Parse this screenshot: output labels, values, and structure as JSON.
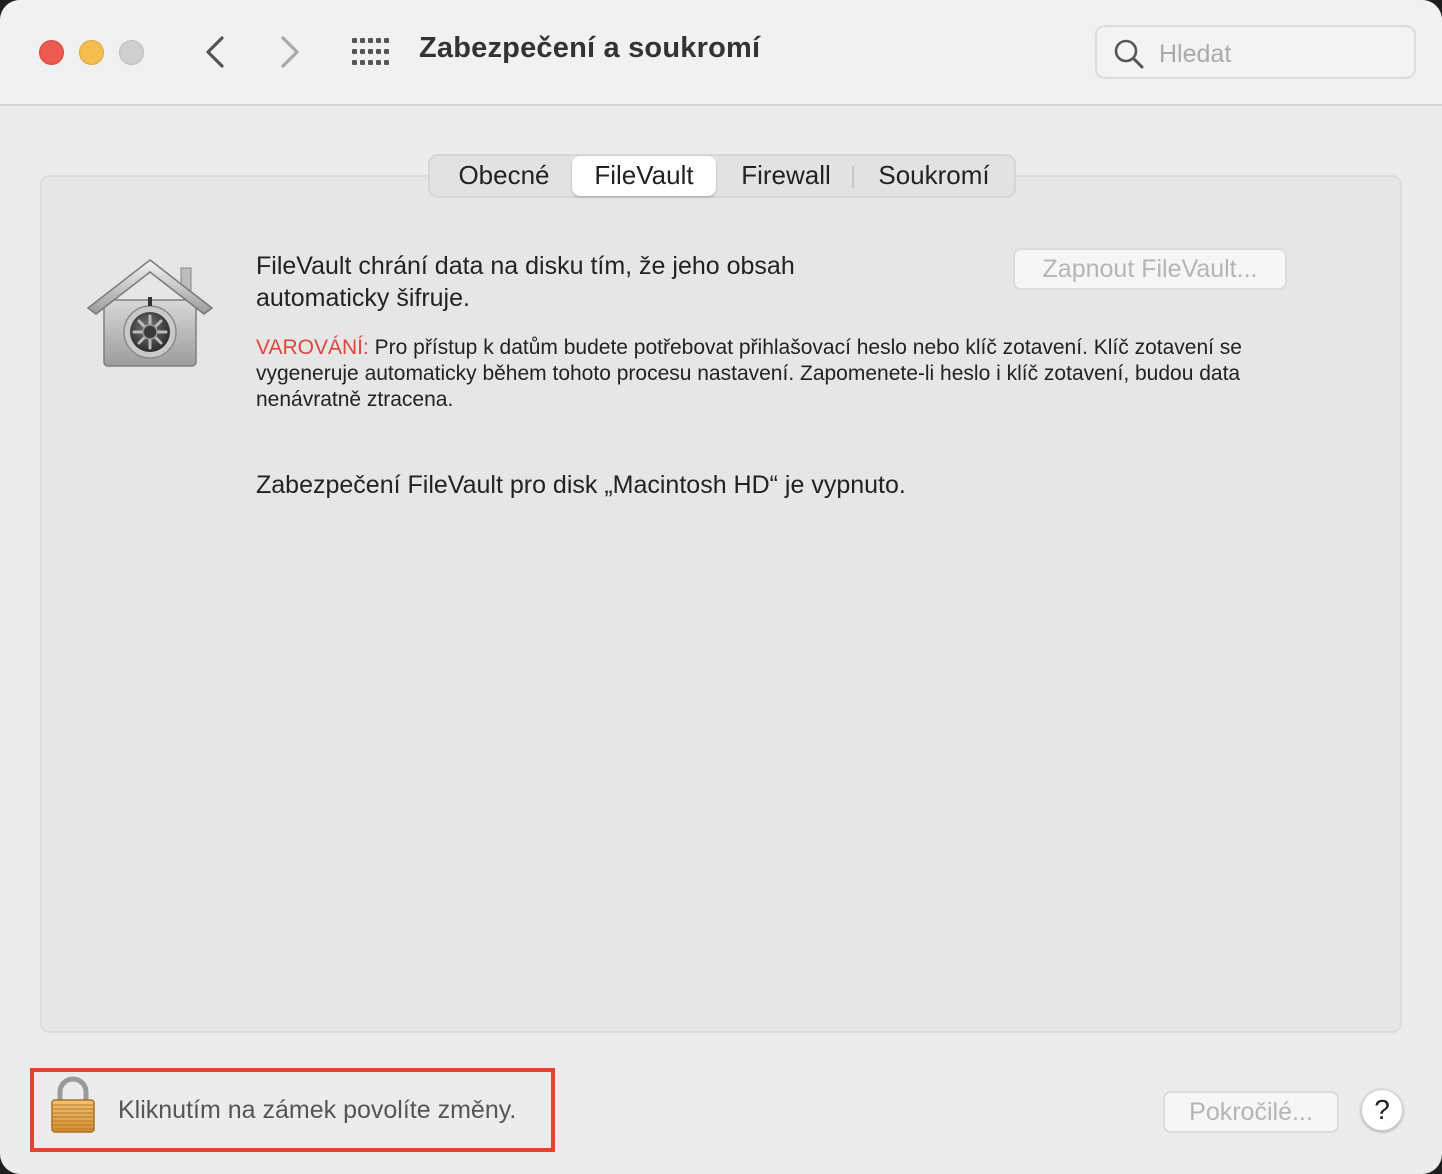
{
  "window": {
    "title": "Zabezpečení a soukromí"
  },
  "search": {
    "placeholder": "Hledat"
  },
  "tabs": [
    {
      "label": "Obecné",
      "active": false
    },
    {
      "label": "FileVault",
      "active": true
    },
    {
      "label": "Firewall",
      "active": false
    },
    {
      "label": "Soukromí",
      "active": false
    }
  ],
  "filevault": {
    "description": "FileVault chrání data na disku tím, že jeho obsah automaticky šifruje.",
    "enable_button": "Zapnout FileVault...",
    "warning_label": "VAROVÁNÍ:",
    "warning_text": " Pro přístup k datům budete potřebovat přihlašovací heslo nebo klíč zotavení. Klíč zotavení se vygeneruje automaticky během tohoto procesu nastavení. Zapomenete-li heslo i klíč zotavení, budou data nenávratně ztracena.",
    "status": "Zabezpečení FileVault pro disk „Macintosh HD“ je vypnuto."
  },
  "footer": {
    "lock_text": "Kliknutím na zámek povolíte změny.",
    "advanced_button": "Pokročilé...",
    "help_label": "?"
  },
  "colors": {
    "warning": "#e0453c",
    "highlight_border": "#e2452d",
    "close": "#ee5a52",
    "minimize": "#f5bd4f",
    "zoom_disabled": "#cfcfcf"
  }
}
